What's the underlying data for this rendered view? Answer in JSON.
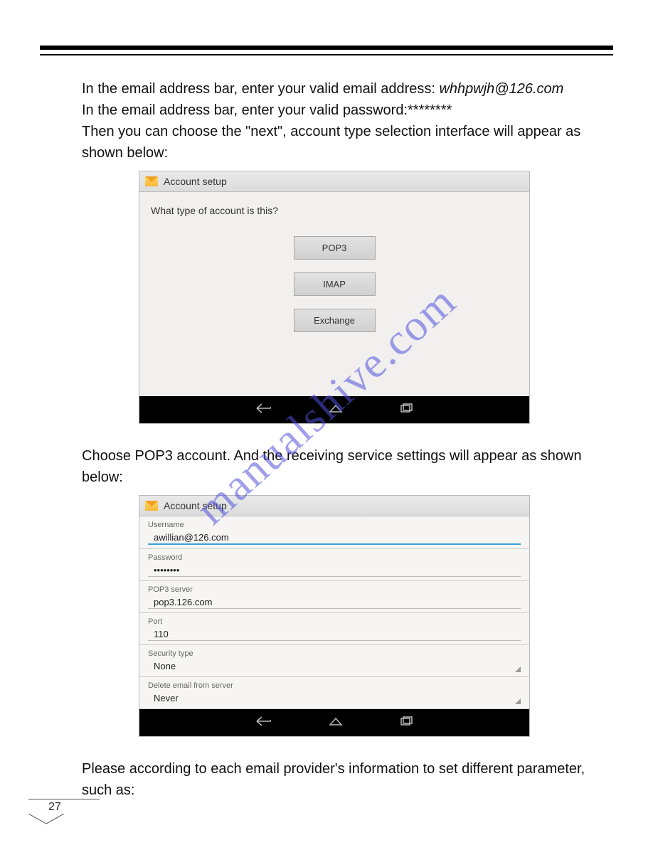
{
  "page_number": "27",
  "watermark": "manualshive.com",
  "intro": {
    "line1_prefix": "In the email address bar, enter your valid email address: ",
    "line1_email": "whhpwjh@126.com",
    "line2": "In the email address bar, enter your valid password:********",
    "line3": "Then you can choose the \"next\", account type selection interface will appear as shown below:"
  },
  "shot1": {
    "header": "Account setup",
    "prompt": "What type of account is this?",
    "buttons": {
      "pop3": "POP3",
      "imap": "IMAP",
      "exchange": "Exchange"
    }
  },
  "mid_text": "Choose POP3 account. And the receiving service settings will appear as shown below:",
  "shot2": {
    "header": "Account setup",
    "fields": {
      "username_label": "Username",
      "username_value": "awillian@126.com",
      "password_label": "Password",
      "password_value": "••••••••",
      "pop3_label": "POP3 server",
      "pop3_value": "pop3.126.com",
      "port_label": "Port",
      "port_value": "110",
      "security_label": "Security type",
      "security_value": "None",
      "delete_label": "Delete email from server",
      "delete_value": "Never"
    }
  },
  "outro": "Please according to each email provider's information to set different parameter, such as:"
}
